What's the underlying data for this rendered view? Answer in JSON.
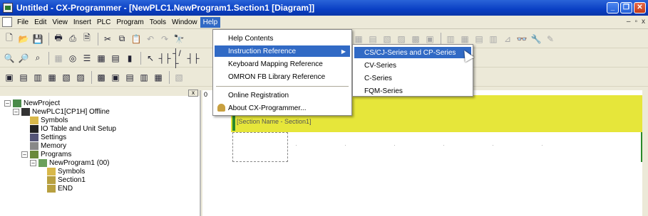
{
  "window": {
    "title": "Untitled - CX-Programmer - [NewPLC1.NewProgram1.Section1 [Diagram]]"
  },
  "menubar": {
    "items": [
      "File",
      "Edit",
      "View",
      "Insert",
      "PLC",
      "Program",
      "Tools",
      "Window",
      "Help"
    ],
    "active": "Help"
  },
  "help_menu": {
    "items": [
      {
        "label": "Help Contents"
      },
      {
        "label": "Instruction Reference",
        "has_submenu": true
      },
      {
        "label": "Keyboard Mapping Reference"
      },
      {
        "label": "OMRON FB Library Reference"
      },
      {
        "label": "Online Registration"
      },
      {
        "label": "About CX-Programmer..."
      }
    ]
  },
  "instruction_submenu": {
    "items": [
      "CS/CJ-Series and CP-Series",
      "CV-Series",
      "C-Series",
      "FQM-Series"
    ]
  },
  "tree": {
    "nodes": [
      {
        "label": "NewProject",
        "level": 0
      },
      {
        "label": "NewPLC1[CP1H] Offline",
        "level": 1
      },
      {
        "label": "Symbols",
        "level": 2
      },
      {
        "label": "IO Table and Unit Setup",
        "level": 2
      },
      {
        "label": "Settings",
        "level": 2
      },
      {
        "label": "Memory",
        "level": 2
      },
      {
        "label": "Programs",
        "level": 2
      },
      {
        "label": "NewProgram1 (00)",
        "level": 3
      },
      {
        "label": "Symbols",
        "level": 4
      },
      {
        "label": "Section1",
        "level": 4
      },
      {
        "label": "END",
        "level": 4
      }
    ]
  },
  "diagram": {
    "rung_number": "0",
    "section_label": "[Section Name - Section1]"
  },
  "colors": {
    "titlebar": "#0a3fc4",
    "highlight": "#316ac5",
    "rung_band": "#e6e63a"
  }
}
